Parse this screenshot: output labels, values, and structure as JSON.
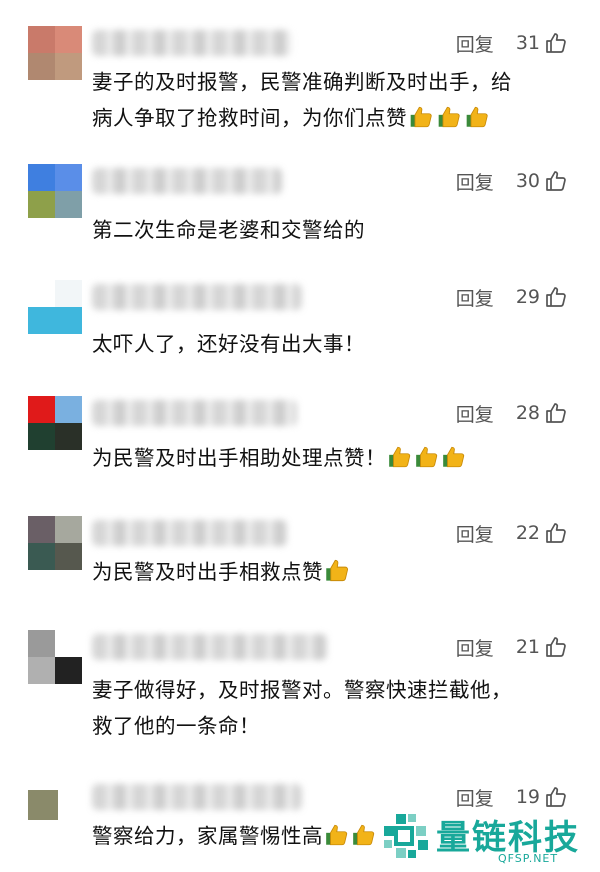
{
  "comments": [
    {
      "reply": "回复",
      "likes": "31",
      "line1": "妻子的及时报警，民警准确判断及时出手，给",
      "line2": "病人争取了抢救时间，为你们点赞",
      "emoji": "thumbs-up-icon",
      "emoji_count": 3,
      "avatar_colors": [
        "#c97a6a",
        "#d98a78",
        "#b08870",
        "#c09a7e"
      ]
    },
    {
      "reply": "回复",
      "likes": "30",
      "line1": "第二次生命是老婆和交警给的",
      "avatar_colors": [
        "#3f7fe0",
        "#5a8ee8",
        "#8ea04a",
        "#7f9fa8"
      ]
    },
    {
      "reply": "回复",
      "likes": "29",
      "line1": "太吓人了，还好没有出大事！",
      "avatar_colors": [
        "#ffffff",
        "#f2f6f8",
        "#3fb7dd",
        "#3fb7dd"
      ]
    },
    {
      "reply": "回复",
      "likes": "28",
      "line1": "为民警及时出手相助处理点赞！",
      "emoji": "thumbs-up-icon",
      "emoji_count": 3,
      "avatar_colors": [
        "#e01a1a",
        "#7ab0e0",
        "#204030",
        "#2a3028"
      ]
    },
    {
      "reply": "回复",
      "likes": "22",
      "line1": "为民警及时出手相救点赞",
      "emoji": "thumbs-up-icon",
      "emoji_count": 1,
      "avatar_colors": [
        "#6a5f66",
        "#a6a89e",
        "#3a5a52",
        "#56584e"
      ]
    },
    {
      "reply": "回复",
      "likes": "21",
      "line1": "妻子做得好，及时报警对。警察快速拦截他，",
      "line2": "救了他的一条命！",
      "avatar_colors": [
        "#9a9a9a",
        "#ffffff",
        "#b0b0b0",
        "#222222"
      ]
    },
    {
      "reply": "回复",
      "likes": "19",
      "line1": "警察给力，家属警惕性高",
      "emoji": "thumbs-up-icon",
      "emoji_count": 2,
      "avatar_colors": [
        "#8a8a6a"
      ]
    }
  ],
  "watermark": {
    "name": "量链科技",
    "url": "QFSP.NET"
  }
}
